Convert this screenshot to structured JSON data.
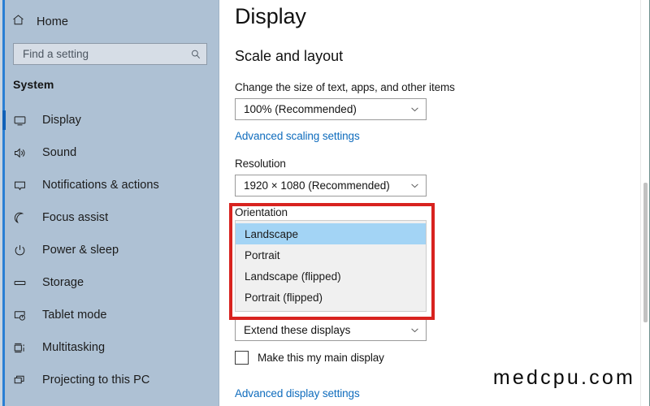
{
  "sidebar": {
    "home": {
      "label": "Home",
      "icon": "home-icon"
    },
    "search": {
      "value": "",
      "placeholder": "Find a setting",
      "icon": "search-icon"
    },
    "section_label": "System",
    "items": [
      {
        "label": "Display",
        "icon": "monitor-icon",
        "selected": true
      },
      {
        "label": "Sound",
        "icon": "speaker-icon",
        "selected": false
      },
      {
        "label": "Notifications & actions",
        "icon": "notification-icon",
        "selected": false
      },
      {
        "label": "Focus assist",
        "icon": "moon-icon",
        "selected": false
      },
      {
        "label": "Power & sleep",
        "icon": "power-icon",
        "selected": false
      },
      {
        "label": "Storage",
        "icon": "storage-icon",
        "selected": false
      },
      {
        "label": "Tablet mode",
        "icon": "tablet-icon",
        "selected": false
      },
      {
        "label": "Multitasking",
        "icon": "multitasking-icon",
        "selected": false
      },
      {
        "label": "Projecting to this PC",
        "icon": "projecting-icon",
        "selected": false
      }
    ]
  },
  "main": {
    "page_title": "Display",
    "section_heading": "Scale and layout",
    "scale": {
      "label": "Change the size of text, apps, and other items",
      "value": "100% (Recommended)",
      "advanced_link": "Advanced scaling settings"
    },
    "resolution": {
      "label": "Resolution",
      "value": "1920 × 1080 (Recommended)"
    },
    "orientation": {
      "label": "Orientation",
      "options": [
        "Landscape",
        "Portrait",
        "Landscape (flipped)",
        "Portrait (flipped)"
      ],
      "selected": "Landscape"
    },
    "multiple_displays": {
      "value": "Extend these displays"
    },
    "main_display_checkbox": {
      "label": "Make this my main display",
      "checked": false
    },
    "advanced_display_link": "Advanced display settings"
  },
  "annotation": {
    "highlight_color": "#d8231f"
  },
  "watermark": {
    "text": "medcpu.com"
  }
}
